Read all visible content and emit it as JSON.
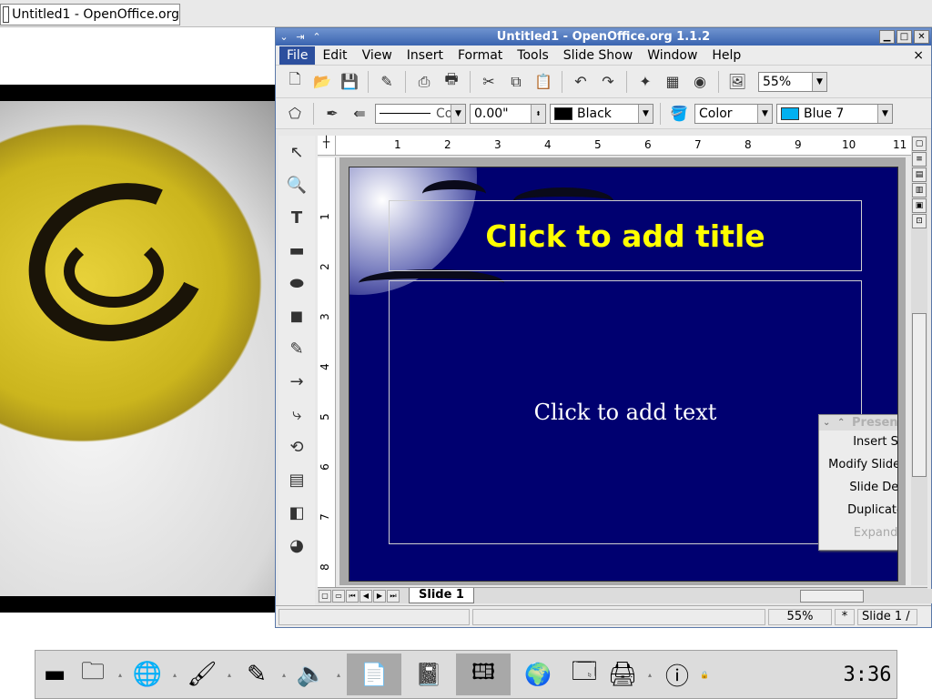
{
  "taskbar_tab": {
    "label": "Untitled1 - OpenOffice.org"
  },
  "window": {
    "title": "Untitled1 - OpenOffice.org 1.1.2",
    "menus": [
      "File",
      "Edit",
      "View",
      "Insert",
      "Format",
      "Tools",
      "Slide Show",
      "Window",
      "Help"
    ],
    "active_menu": "File",
    "close_doc": "×"
  },
  "toolbar1": {
    "zoom": "55%"
  },
  "toolbar2": {
    "line_style": "Co",
    "line_width": "0.00\"",
    "line_color": "Black",
    "area_style": "Color",
    "area_color": "Blue 7",
    "colors": {
      "black": "#000000",
      "blue7": "#00b0f0"
    }
  },
  "ruler": {
    "h_ticks": [
      "1",
      "2",
      "3",
      "4",
      "5",
      "6",
      "7",
      "8",
      "9",
      "10",
      "11"
    ],
    "v_ticks": [
      "1",
      "2",
      "3",
      "4",
      "5",
      "6",
      "7",
      "8"
    ]
  },
  "slide": {
    "title_placeholder": "Click to add title",
    "text_placeholder": "Click to add text",
    "background": "#000070",
    "title_color": "#ffff00"
  },
  "palette": {
    "title": "Presentation",
    "items": [
      "Insert Slide...",
      "Modify Slide Layout...",
      "Slide Design...",
      "Duplicate Slide"
    ],
    "disabled_item": "Expand Slide"
  },
  "tabs": {
    "slide_tab": "Slide 1"
  },
  "statusbar": {
    "zoom": "55%",
    "modified": "*",
    "slide": "Slide 1 /"
  },
  "panel": {
    "clock": "3:36"
  }
}
